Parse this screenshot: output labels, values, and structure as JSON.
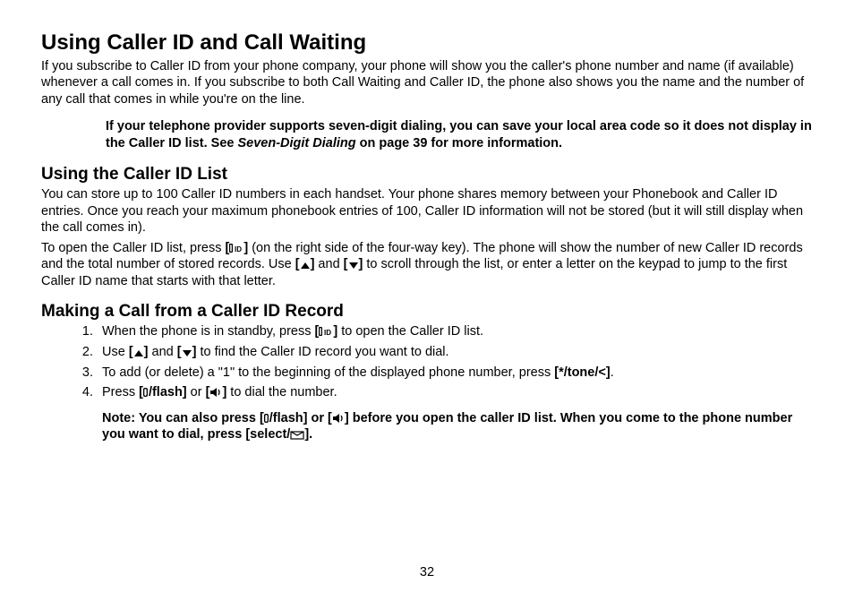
{
  "title": "Using Caller ID and Call Waiting",
  "intro": "If you subscribe to Caller ID from your phone company, your phone will show you the caller's phone number and name (if available) whenever a call comes in. If you subscribe to both Call Waiting and Caller ID, the phone also shows you the name and the number of any call that comes in while you're on the line.",
  "area_code_note_1": "If your telephone provider supports seven-digit dialing, you can save your local area code so it does not display in the Caller ID list. See ",
  "area_code_note_italic": "Seven-Digit Dialing",
  "area_code_note_2": " on page 39 for more information.",
  "list_heading": "Using the Caller ID List",
  "list_p1": "You can store up to 100 Caller ID numbers in each handset. Your phone shares memory between your Phonebook and Caller ID entries. Once you reach your maximum phonebook entries of 100, Caller ID information will not be stored (but it will still display when the call comes in).",
  "list_p2_a": "To open the Caller ID list, press ",
  "cid_key": "[",
  "cid_key_close": "]",
  "list_p2_b": " (on the right side of the four-way key). The phone will show the number of new Caller ID records and the total number of stored records. Use ",
  "up_key": "[▲]",
  "and": " and ",
  "down_key": "[▼]",
  "list_p2_c": "  to scroll through the list, or enter a letter on the keypad to jump to the first Caller ID name that starts with that letter.",
  "call_heading": "Making a Call from a Caller ID Record",
  "steps": {
    "s1a": "When the phone is in standby, press ",
    "s1b": " to open the Caller ID list.",
    "s2a": "Use ",
    "s2b": " to find the Caller ID record you want to dial.",
    "s3a": "To add (or delete) a \"1\" to the beginning of the displayed phone number, press ",
    "tone_key": "[*/tone/<]",
    "s3b": ".",
    "s4a": "Press ",
    "flash_key": "[ /flash]",
    "or": " or ",
    "speaker_key": "[  ]",
    "s4b": " to dial the number."
  },
  "note2_a": "Note: You can also press ",
  "note2_b": " before you open the caller ID list. When you come to the phone number you want to dial, press  ",
  "select_key": "[select/   ]",
  "note2_c": ".",
  "page_number": "32"
}
